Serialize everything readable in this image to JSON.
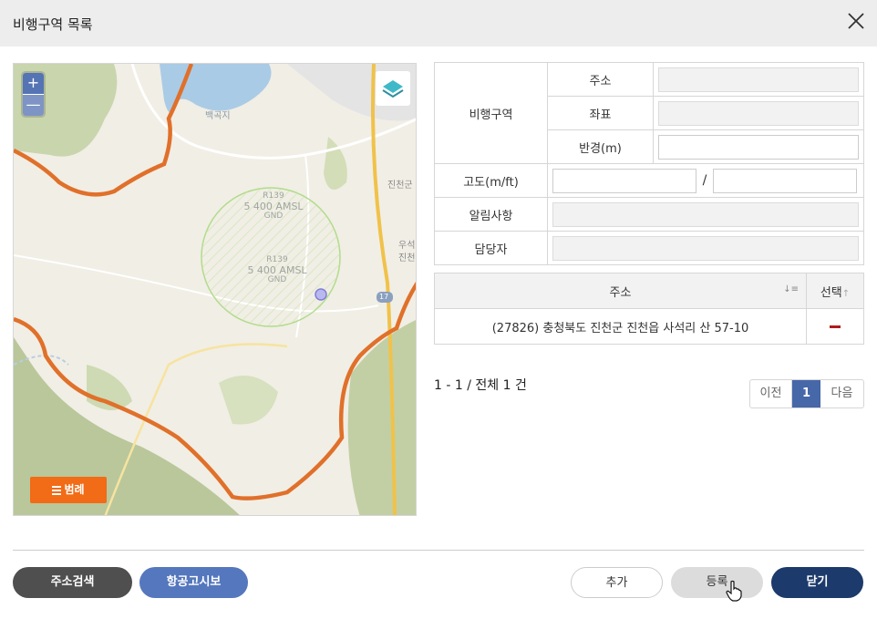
{
  "header": {
    "title": "비행구역 목록"
  },
  "map": {
    "zoom_in": "+",
    "zoom_out": "—",
    "legend_label": "범례",
    "zone_labels": [
      {
        "name": "R139",
        "alt": "5 400 AMSL",
        "base": "GND"
      },
      {
        "name": "R139",
        "alt": "5 400 AMSL",
        "base": "GND"
      }
    ],
    "place_labels": [
      "백곡지",
      "진천군",
      "우석",
      "진천",
      "17"
    ]
  },
  "form": {
    "zone_label": "비행구역",
    "address_label": "주소",
    "coord_label": "좌표",
    "radius_label": "반경(m)",
    "altitude_label": "고도(m/ft)",
    "altitude_sep": "/",
    "notice_label": "알림사항",
    "manager_label": "담당자",
    "address_value": "",
    "coord_value": "",
    "radius_value": "",
    "altitude_min": "",
    "altitude_max": "",
    "notice_value": "",
    "manager_value": ""
  },
  "list": {
    "col_address": "주소",
    "col_select": "선택",
    "rows": [
      {
        "address": "(27826) 충청북도 진천군 진천읍 사석리 산 57-10"
      }
    ]
  },
  "pagination": {
    "summary": "1 - 1 / 전체 1 건",
    "prev": "이전",
    "current": "1",
    "next": "다음"
  },
  "footer": {
    "address_search": "주소검색",
    "notam": "항공고시보",
    "add": "추가",
    "register": "등록",
    "close": "닫기"
  },
  "colors": {
    "boundary": "#e0702a",
    "zone": "#a8d67a",
    "primary": "#1c3a6b",
    "accent": "#5577bd",
    "legend": "#f26b16"
  }
}
